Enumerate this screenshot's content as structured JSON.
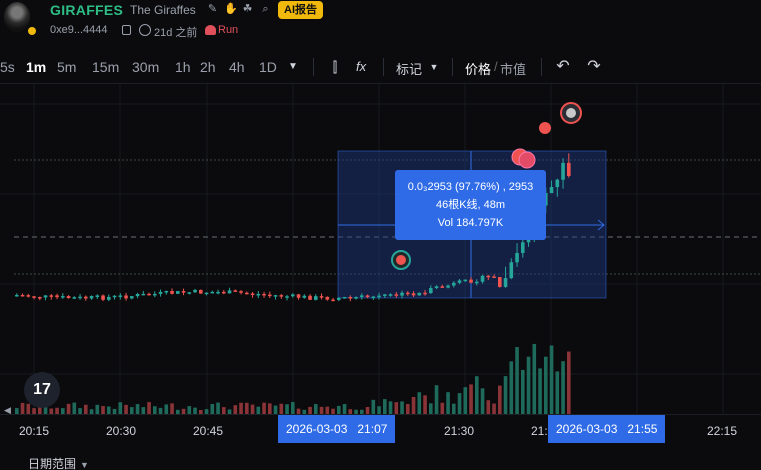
{
  "header": {
    "symbol": "GIRAFFES",
    "name": "The Giraffes",
    "ai_badge": "AI报告",
    "address": "0xe9...4444",
    "age": "21d 之前",
    "run_label": "Run"
  },
  "toolbar": {
    "timeframes": [
      "5s",
      "1m",
      "5m",
      "15m",
      "30m",
      "1h",
      "2h",
      "4h",
      "1D"
    ],
    "active_timeframe": "1m",
    "marker_label": "标记",
    "price_label": "价格",
    "mcap_label": "市值",
    "fx_label": "fx"
  },
  "tooltip": {
    "line1": "0.0₃2953 (97.76%) , 2953",
    "line2": "46根K线, 48m",
    "line3": "Vol 184.797K"
  },
  "time_axis": {
    "ticks": [
      "20:15",
      "20:30",
      "20:45",
      "21:30",
      "21:",
      "22:15"
    ],
    "range_start": "2026-03-03   21:07",
    "range_end": "2026-03-03   21:55"
  },
  "footer": {
    "date_range_label": "日期范围"
  },
  "colors": {
    "up": "#26a69a",
    "down": "#ef5350",
    "accent": "#2f6be6",
    "brand": "#2ebd85"
  }
}
